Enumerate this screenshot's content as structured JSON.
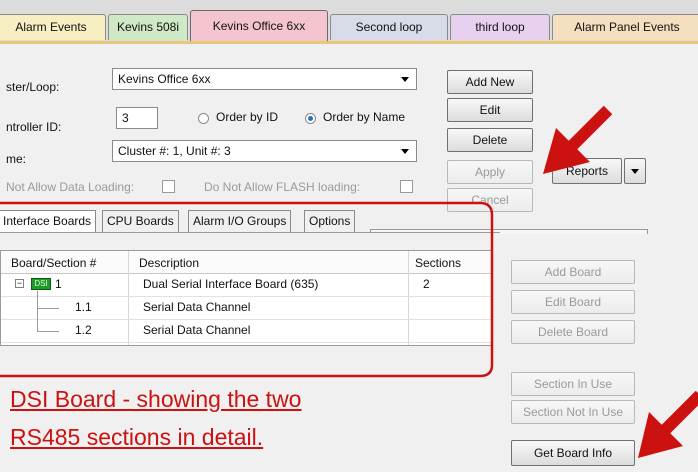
{
  "top_tabs": [
    {
      "label": "Alarm Events",
      "color": "#f7efc2"
    },
    {
      "label": "Kevins 508i",
      "color": "#cfe9c7"
    },
    {
      "label": "Kevins Office 6xx",
      "color": "#f4c5cf"
    },
    {
      "label": "Second loop",
      "color": "#d8dce8"
    },
    {
      "label": "third loop",
      "color": "#e7d1ef"
    },
    {
      "label": "Alarm Panel Events",
      "color": "#f4dfc0"
    }
  ],
  "form": {
    "cluster_loop_label": "ster/Loop:",
    "cluster_loop_value": "Kevins Office 6xx",
    "controller_id_label": "ntroller ID:",
    "controller_id_value": "3",
    "order_by_id_label": "Order by ID",
    "order_by_name_label": "Order by Name",
    "name_label": "me:",
    "name_value": "Cluster #: 1, Unit #: 3",
    "no_data_loading_label": "Not Allow Data Loading:",
    "no_flash_loading_label": "Do Not Allow FLASH loading:"
  },
  "buttons": {
    "add_new": "Add New",
    "edit": "Edit",
    "delete": "Delete",
    "apply": "Apply",
    "cancel": "Cancel",
    "reports": "Reports"
  },
  "inner_tabs": [
    "Interface Boards",
    "CPU Boards",
    "Alarm I/O Groups",
    "Options"
  ],
  "grid": {
    "columns": [
      "Board/Section #",
      "Description",
      "Sections"
    ],
    "rows": [
      {
        "id": "1",
        "description": "Dual Serial Interface Board (635)",
        "sections": "2"
      },
      {
        "id": "1.1",
        "description": "Serial Data Channel",
        "sections": ""
      },
      {
        "id": "1.2",
        "description": "Serial Data Channel",
        "sections": ""
      }
    ],
    "board_icon_text": "DSI"
  },
  "board_buttons": {
    "add_board": "Add Board",
    "edit_board": "Edit Board",
    "delete_board": "Delete Board",
    "section_in_use": "Section In Use",
    "section_not_in_use": "Section Not In Use",
    "get_board_info": "Get Board Info"
  },
  "annotation": {
    "line1": "DSI Board - showing the two",
    "line2": "RS485 sections in detail.",
    "color": "#cc1111"
  }
}
